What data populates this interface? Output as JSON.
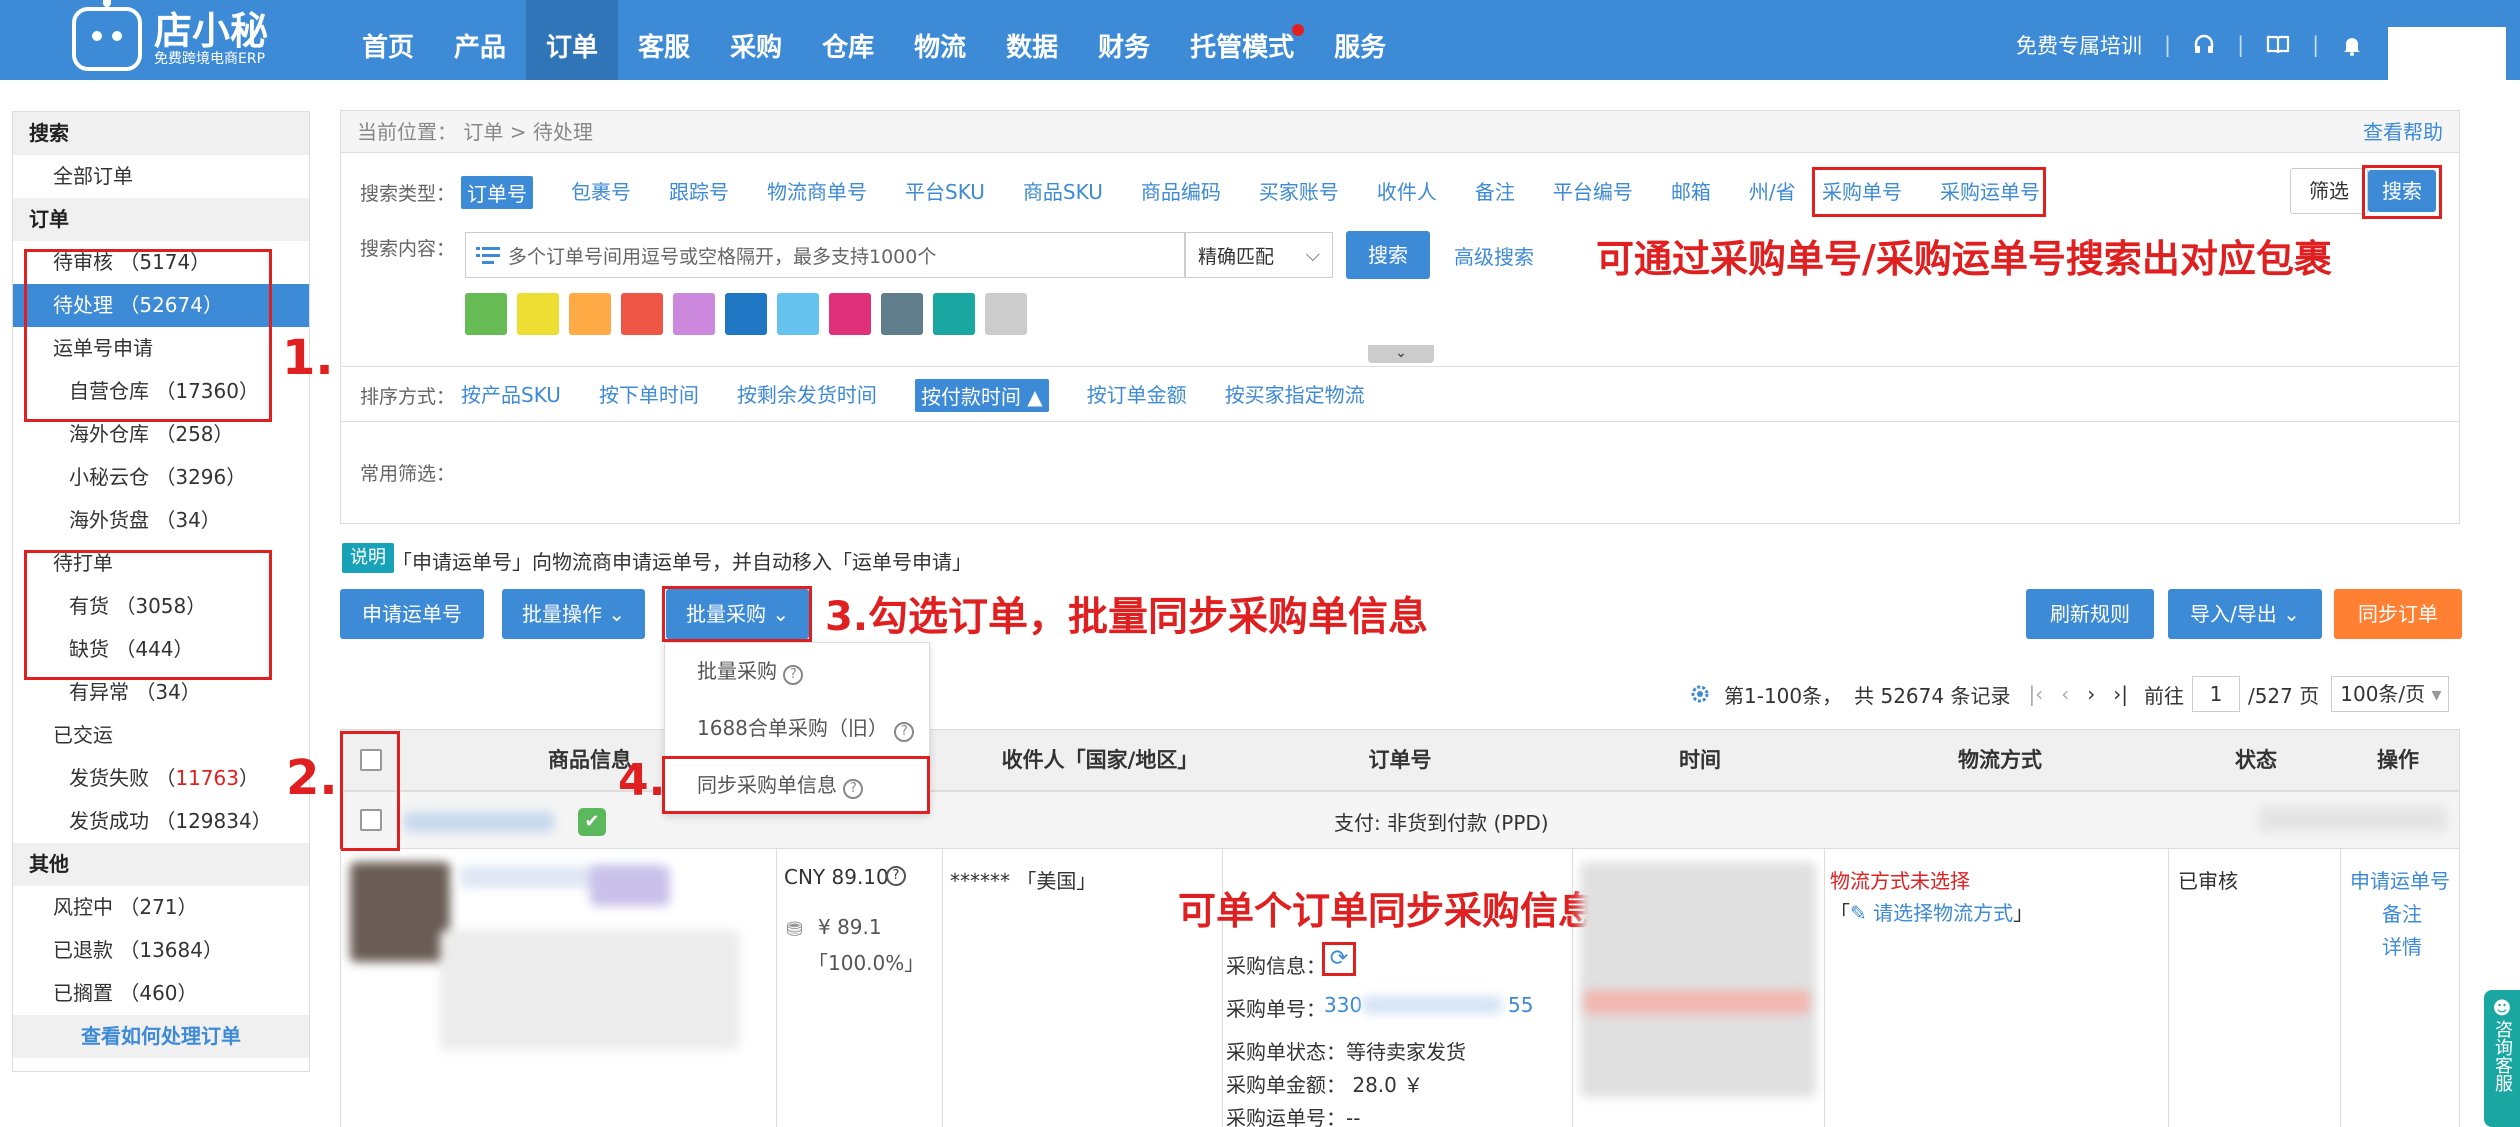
{
  "app": {
    "logo_name": "店小秘",
    "logo_sub": "免费跨境电商ERP"
  },
  "nav": {
    "items": [
      "首页",
      "产品",
      "订单",
      "客服",
      "采购",
      "仓库",
      "物流",
      "数据",
      "财务",
      "托管模式",
      "服务"
    ],
    "active_index": 2,
    "right_training": "免费专属培训"
  },
  "sidebar": {
    "sec_search": "搜索",
    "all_orders": "全部订单",
    "sec_order": "订单",
    "pending_review": "待审核 （5174）",
    "pending_process": "待处理 （52674）",
    "waybill_apply": "运单号申请",
    "self_wh": "自营仓库 （17360）",
    "overseas_wh": "海外仓库 （258）",
    "cloud_wh": "小秘云仓 （3296）",
    "overseas_pallet": "海外货盘 （34）",
    "to_print": "待打单",
    "in_stock": "有货 （3058）",
    "out_stock": "缺货 （444）",
    "abnormal": "有异常 （34）",
    "shipped": "已交运",
    "ship_fail_label": "发货失败 （",
    "ship_fail_count": "11763",
    "ship_fail_end": "）",
    "ship_success": "发货成功 （129834）",
    "sec_other": "其他",
    "risk": "风控中 （271）",
    "refunded": "已退款 （13684）",
    "shelved": "已搁置 （460）",
    "howto": "查看如何处理订单"
  },
  "breadcrumb": {
    "text": "当前位置： 订单  >  待处理",
    "help": "查看帮助"
  },
  "search": {
    "type_label": "搜索类型：",
    "types": [
      "订单号",
      "包裹号",
      "跟踪号",
      "物流商单号",
      "平台SKU",
      "商品SKU",
      "商品编码",
      "买家账号",
      "收件人",
      "备注",
      "平台编号",
      "邮箱",
      "州/省"
    ],
    "types_boxed": [
      "采购单号",
      "采购运单号"
    ],
    "filter_btn": "筛选",
    "search_btn": "搜索",
    "content_label": "搜索内容：",
    "placeholder": "多个订单号间用逗号或空格隔开，最多支持1000个",
    "match": "精确匹配",
    "search_btn2": "搜索",
    "advanced": "高级搜索",
    "swatches": [
      "#66bb55",
      "#eedd33",
      "#ffaa44",
      "#ee5544",
      "#cc88dd",
      "#1f77c4",
      "#66c2ee",
      "#e0307a",
      "#607d8b",
      "#1aa7a2",
      "#cccccc"
    ],
    "sort_label": "排序方式：",
    "sorts": [
      "按产品SKU",
      "按下单时间",
      "按剩余发货时间",
      "按付款时间 ▲",
      "按订单金额",
      "按买家指定物流"
    ],
    "common_label": "常用筛选："
  },
  "notice": {
    "tag": "说明",
    "text": "「申请运单号」向物流商申请运单号，并自动移入「运单号申请」"
  },
  "toolbar": {
    "apply": "申请运单号",
    "batch_op": "批量操作",
    "batch_purchase": "批量采购",
    "refresh": "刷新规则",
    "import_export": "导入/导出",
    "sync": "同步订单"
  },
  "dropdown": {
    "items": [
      "批量采购",
      "1688合单采购（旧）",
      "同步采购单信息"
    ]
  },
  "pagination": {
    "range": "第1-100条，",
    "total": "共 52674 条记录",
    "goto": "前往",
    "page": "1",
    "pages": "/527 页",
    "per_page": "100条/页"
  },
  "table": {
    "headers": [
      "商品信息",
      "收件人「国家/地区」",
      "订单号",
      "时间",
      "物流方式",
      "状态",
      "操作"
    ],
    "payment": "支付: 非货到付款 (PPD)",
    "amount": "CNY 89.10",
    "amount2": "¥ 89.1",
    "ratio": "「100.0%」",
    "recipient": "****** 「美国」",
    "purchase_info": "采购信息：",
    "purchase_no_label": "采购单号：",
    "purchase_no_a": "330",
    "purchase_no_b": "55",
    "purchase_status": "采购单状态：等待卖家发货",
    "purchase_amount": "采购单金额： 28.0 ￥",
    "purchase_waybill": "采购运单号：--",
    "logistics_unset": "物流方式未选择",
    "choose_logistics": "请选择物流方式",
    "status": "已审核",
    "ops": [
      "申请运单号",
      "备注",
      "详情"
    ]
  },
  "annotations": {
    "a1": "1.",
    "a2": "2.",
    "a4": "4.",
    "a3": "3.勾选订单，批量同步采购单信息",
    "top": "可通过采购单号/采购运单号搜索出对应包裹",
    "single": "可单个订单同步采购信息"
  },
  "float": {
    "label": "咨询客服"
  }
}
